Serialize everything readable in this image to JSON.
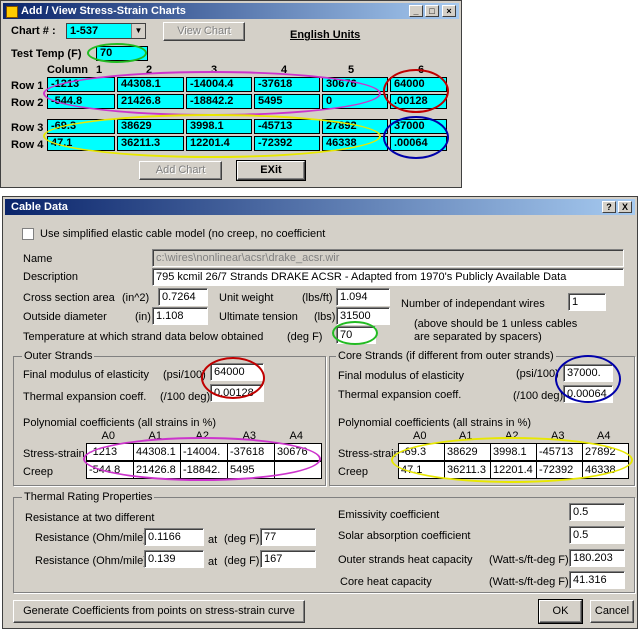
{
  "chart_window": {
    "title": "Add / View Stress-Strain Charts",
    "chart_label": "Chart # :",
    "chart_value": "1-537",
    "view_chart": "View Chart",
    "units": "English Units",
    "test_temp_label": "Test Temp (F)",
    "test_temp_value": "70",
    "column_header": "Column",
    "col_numbers": [
      "1",
      "2",
      "3",
      "4",
      "5",
      "6"
    ],
    "row_labels": [
      "Row 1",
      "Row 2",
      "Row 3",
      "Row 4"
    ],
    "rows": [
      [
        "-1213",
        "44308.1",
        "-14004.4",
        "-37618",
        "30676",
        "64000"
      ],
      [
        "-544.8",
        "21426.8",
        "-18842.2",
        "5495",
        "0",
        ".00128"
      ],
      [
        "-69.3",
        "38629",
        "3998.1",
        "-45713",
        "27892",
        "37000"
      ],
      [
        "47.1",
        "36211.3",
        "12201.4",
        "-72392",
        "46338",
        ".00064"
      ]
    ],
    "add_chart": "Add Chart",
    "exit": "EXit"
  },
  "cable_window": {
    "title": "Cable Data",
    "help_btn": "?",
    "close_btn": "X",
    "simplified_label": "Use simplified elastic cable model (no creep, no coefficient",
    "name_label": "Name",
    "name_value": "c:\\wires\\nonlinear\\acsr\\drake_acsr.wir",
    "description_label": "Description",
    "description_value": "795 kcmil 26/7 Strands DRAKE ACSR - Adapted from 1970's Publicly Available Data",
    "cross_label": "Cross section area",
    "cross_unit": "(in^2)",
    "cross_value": "0.7264",
    "outside_label": "Outside diameter",
    "outside_unit": "(in)",
    "outside_value": "1.108",
    "unit_weight_label": "Unit weight",
    "unit_weight_unit": "(lbs/ft)",
    "unit_weight_value": "1.094",
    "ult_label": "Ultimate tension",
    "ult_unit": "(lbs)",
    "ult_value": "31500",
    "temp_label": "Temperature at which strand data below obtained",
    "temp_unit": "(deg F)",
    "temp_value": "70",
    "indep_label": "Number of independant wires",
    "indep_value": "1",
    "indep_note1": "(above should be 1 unless cables",
    "indep_note2": "are separated by spacers)",
    "outer": {
      "title": "Outer Strands",
      "modulus_label": "Final modulus of elasticity",
      "modulus_unit": "(psi/100)",
      "modulus_value": "64000",
      "thermal_label": "Thermal expansion coeff.",
      "thermal_unit": "(/100 deg)",
      "thermal_value": "0.00128",
      "poly_label": "Polynomial coefficients (all strains in %)",
      "headers": [
        "A0",
        "A1",
        "A2",
        "A3",
        "A4"
      ],
      "stress_label": "Stress-strain",
      "creep_label": "Creep",
      "stress": [
        "-1213",
        "44308.1",
        "-14004.",
        "-37618",
        "30676"
      ],
      "creep": [
        "-544.8",
        "21426.8",
        "-18842.",
        "5495",
        ""
      ]
    },
    "core": {
      "title": "Core Strands (if different from outer strands)",
      "modulus_label": "Final modulus of elasticity",
      "modulus_unit": "(psi/100)",
      "modulus_value": "37000.",
      "thermal_label": "Thermal expansion coeff.",
      "thermal_unit": "(/100 deg)",
      "thermal_value": "0.00064",
      "poly_label": "Polynomial coefficients (all strains in %)",
      "headers": [
        "A0",
        "A1",
        "A2",
        "A3",
        "A4"
      ],
      "stress_label": "Stress-strain",
      "creep_label": "Creep",
      "stress": [
        "-69.3",
        "38629",
        "3998.1",
        "-45713",
        "27892"
      ],
      "creep": [
        "47.1",
        "36211.3",
        "12201.4",
        "-72392",
        "46338"
      ]
    },
    "thermal": {
      "title": "Thermal Rating Properties",
      "resist_title": "Resistance at two different",
      "res_label": "Resistance (Ohm/mile)",
      "at_label": "at",
      "degf_label": "(deg F)",
      "res1": "0.1166",
      "temp1": "77",
      "res2": "0.139",
      "temp2": "167",
      "emiss_label": "Emissivity coefficient",
      "emiss_value": "0.5",
      "solar_label": "Solar absorption coefficient",
      "solar_value": "0.5",
      "outer_heat_label": "Outer strands heat capacity",
      "heat_unit": "(Watt-s/ft-deg F)",
      "outer_heat_value": "180.203",
      "core_heat_label": "Core heat capacity",
      "core_heat_value": "41.316"
    },
    "generate_btn": "Generate Coefficients from points on stress-strain curve",
    "ok_btn": "OK",
    "cancel_btn": "Cancel"
  },
  "colors": {
    "titlebar": "#0a246a",
    "cell_cyan": "#00ffff",
    "ring_red": "#c00000",
    "ring_magenta": "#cc33cc",
    "ring_blue": "#0000aa",
    "ring_yellow": "#e8e800",
    "ring_green": "#22bb22"
  }
}
